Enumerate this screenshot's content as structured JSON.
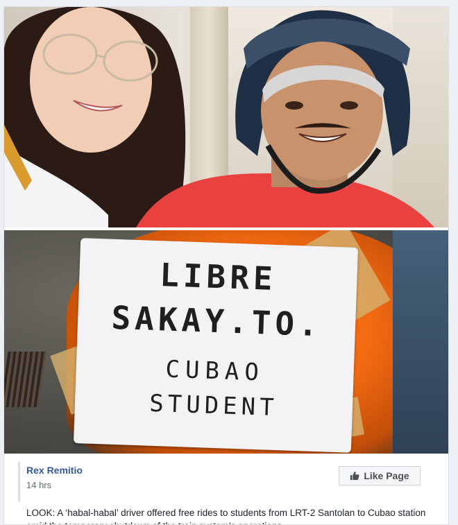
{
  "photo_top": {
    "icon": "photo-selfie-student-and-driver"
  },
  "photo_bottom": {
    "sign": {
      "line1": "LIBRE",
      "line2": "SAKAY.TO.",
      "line3": "CUBAO",
      "line4": "STUDENT"
    }
  },
  "post": {
    "page_name": "Rex Remitio",
    "time": "14 hrs",
    "like_button": "Like Page",
    "text": "LOOK: A ‘habal-habal’ driver offered free rides to students from LRT-2 Santolan to Cubao station amid the temporary shutdown of the train system’s operations."
  },
  "colors": {
    "link_blue": "#365899",
    "bike_orange": "#f26a12"
  }
}
